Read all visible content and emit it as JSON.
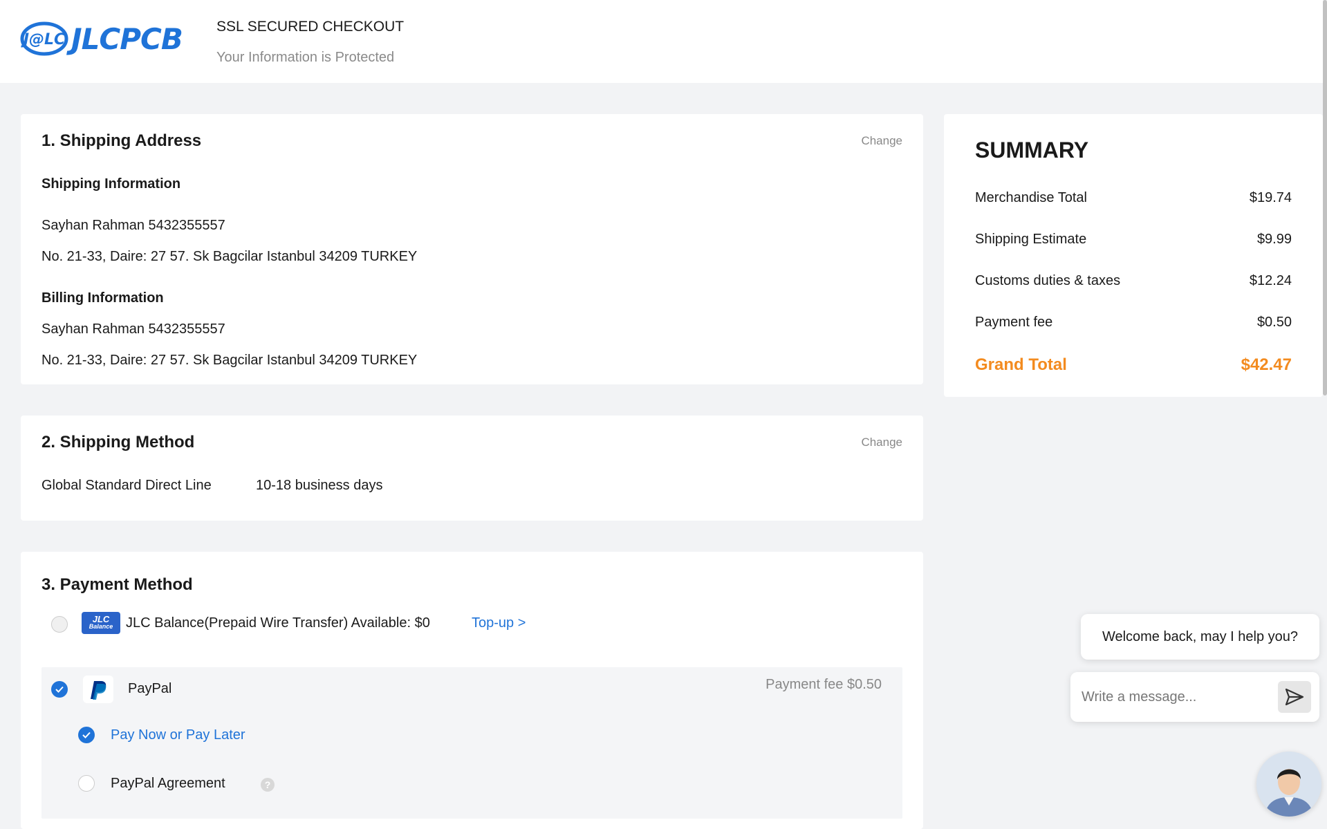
{
  "header": {
    "logo_mark": "J@LC",
    "logo_text": "JLCPCB",
    "ssl_title": "SSL SECURED CHECKOUT",
    "ssl_subtitle": "Your Information is Protected"
  },
  "shipping_address": {
    "title": "1. Shipping Address",
    "change_label": "Change",
    "shipping_heading": "Shipping Information",
    "shipping_name_phone": "Sayhan Rahman 5432355557",
    "shipping_address": "No. 21-33, Daire: 27 57. Sk Bagcilar Istanbul 34209 TURKEY",
    "billing_heading": "Billing Information",
    "billing_name_phone": "Sayhan Rahman 5432355557",
    "billing_address": "No. 21-33, Daire: 27 57. Sk Bagcilar Istanbul 34209 TURKEY"
  },
  "shipping_method": {
    "title": "2. Shipping Method",
    "change_label": "Change",
    "method": "Global Standard Direct Line",
    "duration": "10-18 business days"
  },
  "payment_method": {
    "title": "3. Payment Method",
    "jlc_balance": {
      "icon_text_1": "JLC",
      "icon_text_2": "Balance",
      "label": "JLC Balance(Prepaid Wire Transfer) Available: $0",
      "topup_label": "Top-up >",
      "selected": false
    },
    "paypal": {
      "label": "PayPal",
      "fee": "Payment fee $0.50",
      "selected": true,
      "options": [
        {
          "label": "Pay Now or Pay Later",
          "selected": true
        },
        {
          "label": "PayPal Agreement",
          "selected": false,
          "help_icon": "question-icon"
        }
      ]
    }
  },
  "summary": {
    "title": "SUMMARY",
    "rows": [
      {
        "label": "Merchandise Total",
        "value": "$19.74"
      },
      {
        "label": "Shipping Estimate",
        "value": "$9.99"
      },
      {
        "label": "Customs duties & taxes",
        "value": "$12.24"
      },
      {
        "label": "Payment fee",
        "value": "$0.50"
      }
    ],
    "grand_total_label": "Grand Total",
    "grand_total_value": "$42.47"
  },
  "chat": {
    "welcome": "Welcome back, may I help you?",
    "input_placeholder": "Write a message..."
  },
  "colors": {
    "brand_blue": "#1f73d8",
    "grand_total_orange": "#f38b1f",
    "background": "#f2f3f5"
  }
}
